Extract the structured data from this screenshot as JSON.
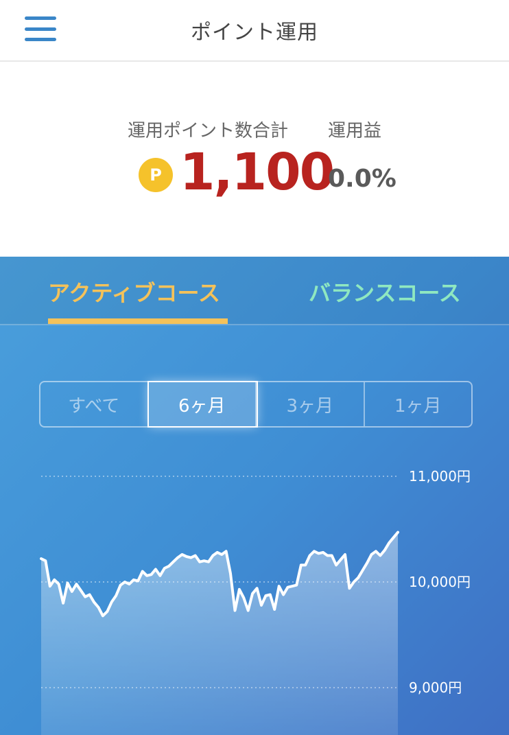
{
  "header": {
    "title": "ポイント運用",
    "menu_icon": "hamburger-menu-icon"
  },
  "summary": {
    "total_label": "運用ポイント数合計",
    "total_value": "1,100",
    "coin_letter": "P",
    "profit_label": "運用益",
    "profit_value": "0.0%"
  },
  "tabs": [
    {
      "label": "アクティブコース",
      "active": true
    },
    {
      "label": "バランスコース",
      "active": false
    }
  ],
  "period": {
    "options": [
      "すべて",
      "6ヶ月",
      "3ヶ月",
      "1ヶ月"
    ],
    "selected": "6ヶ月"
  },
  "colors": {
    "accent_blue": "#3a86c8",
    "points_red": "#b8231f",
    "active_tab": "#f4c25a",
    "inactive_tab": "#8fe8c0",
    "coin": "#f5c22b"
  },
  "chart_data": {
    "type": "area",
    "ylim": [
      8700,
      11200
    ],
    "yticks": [
      {
        "value": 11000,
        "label": "11,000円"
      },
      {
        "value": 10000,
        "label": "10,000円"
      },
      {
        "value": 9000,
        "label": "9,000円"
      }
    ],
    "grid": true,
    "values": [
      10220,
      10200,
      9960,
      10020,
      9980,
      9800,
      9990,
      9910,
      9980,
      9920,
      9860,
      9880,
      9810,
      9760,
      9680,
      9720,
      9810,
      9870,
      9970,
      10000,
      9980,
      10020,
      10010,
      10100,
      10060,
      10070,
      10120,
      10060,
      10130,
      10150,
      10190,
      10230,
      10260,
      10240,
      10230,
      10250,
      10190,
      10200,
      10190,
      10250,
      10280,
      10260,
      10290,
      10080,
      9730,
      9930,
      9850,
      9730,
      9890,
      9940,
      9780,
      9870,
      9880,
      9740,
      9960,
      9880,
      9950,
      9960,
      9970,
      10160,
      10160,
      10250,
      10290,
      10270,
      10280,
      10250,
      10250,
      10160,
      10210,
      10260,
      9940,
      10000,
      10040,
      10110,
      10180,
      10260,
      10290,
      10250,
      10300,
      10370,
      10420,
      10470
    ]
  }
}
